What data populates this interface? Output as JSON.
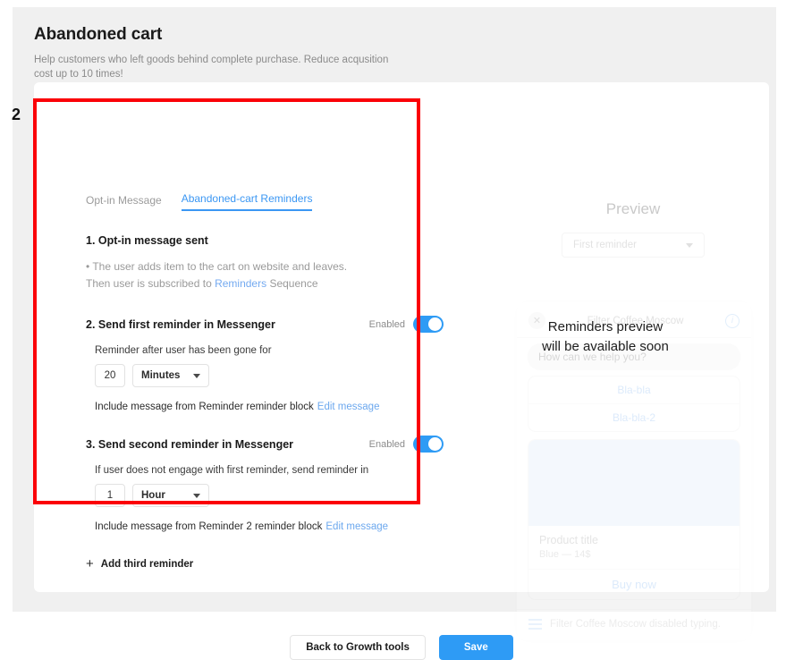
{
  "header": {
    "title": "Abandoned cart",
    "subtitle": "Help customers who left goods behind complete purchase. Reduce acqusition cost up to 10 times!"
  },
  "annotation": {
    "label": "2",
    "color": "#fb0007"
  },
  "tabs": [
    {
      "label": "Opt-in Message",
      "active": false
    },
    {
      "label": "Abandoned-cart Reminders",
      "active": true
    }
  ],
  "steps": [
    {
      "title": "1. Opt-in message sent",
      "desc_line1": "• The user adds item to the cart on website and leaves.",
      "desc_line2_pre": "Then user is subscribed to ",
      "desc_link": "Reminders",
      "desc_line2_post": " Sequence"
    },
    {
      "title": "2. Send first reminder in Messenger",
      "toggle_label": "Enabled",
      "toggle_on": true,
      "field_label": "Reminder after user has been gone for",
      "amount": "20",
      "unit": "Minutes",
      "include_text": "Include message from Reminder reminder block",
      "edit_link": "Edit message"
    },
    {
      "title": "3. Send second reminder in Messenger",
      "toggle_label": "Enabled",
      "toggle_on": true,
      "field_label": "If user does not engage with first reminder, send reminder in",
      "amount": "1",
      "unit": "Hour",
      "include_text": "Include message from Reminder 2 reminder block",
      "edit_link": "Edit message"
    }
  ],
  "add_reminder": {
    "label": "Add third reminder",
    "icon": "plus-icon"
  },
  "preview": {
    "title": "Preview",
    "selected": "First reminder",
    "overlay_line1": "Reminders preview",
    "overlay_line2": "will be available soon",
    "chat": {
      "page_name": "Filter Coffee Moscow",
      "greeting": "How can we help you?",
      "quick_replies": [
        "Bla-bla",
        "Bla-bla-2"
      ],
      "product_title": "Product title",
      "product_sub": "Blue — 14$",
      "buy_label": "Buy now",
      "footer_text": "Filter Coffee Moscow disabled typing."
    }
  },
  "footer": {
    "back_label": "Back to Growth tools",
    "save_label": "Save"
  },
  "colors": {
    "accent": "#2e9bf5",
    "link": "#6ca8ee",
    "annotation": "#fb0007",
    "page_bg": "#f0f0f0"
  }
}
